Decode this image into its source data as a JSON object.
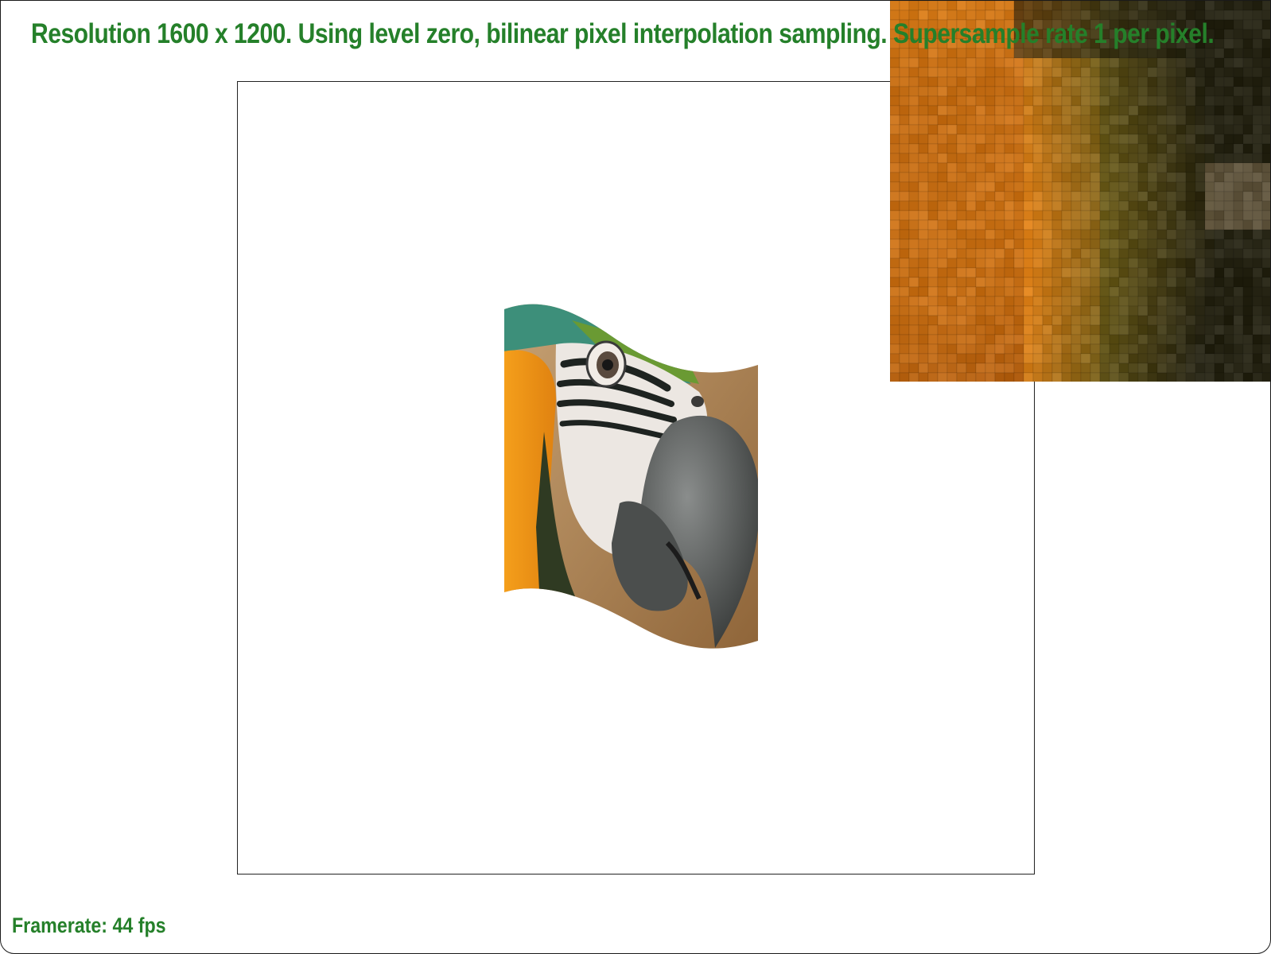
{
  "status": {
    "line": "Resolution 1600 x 1200. Using level zero, bilinear pixel interpolation sampling. Supersample rate 1 per pixel."
  },
  "footer": {
    "framerate": "Framerate: 44 fps"
  },
  "colors": {
    "status_text": "#25802a",
    "viewport_border": "#222222",
    "background": "#ffffff"
  },
  "icons": {
    "texture": "parrot-texture-icon",
    "zoom": "pixel-zoom-inset-icon"
  }
}
